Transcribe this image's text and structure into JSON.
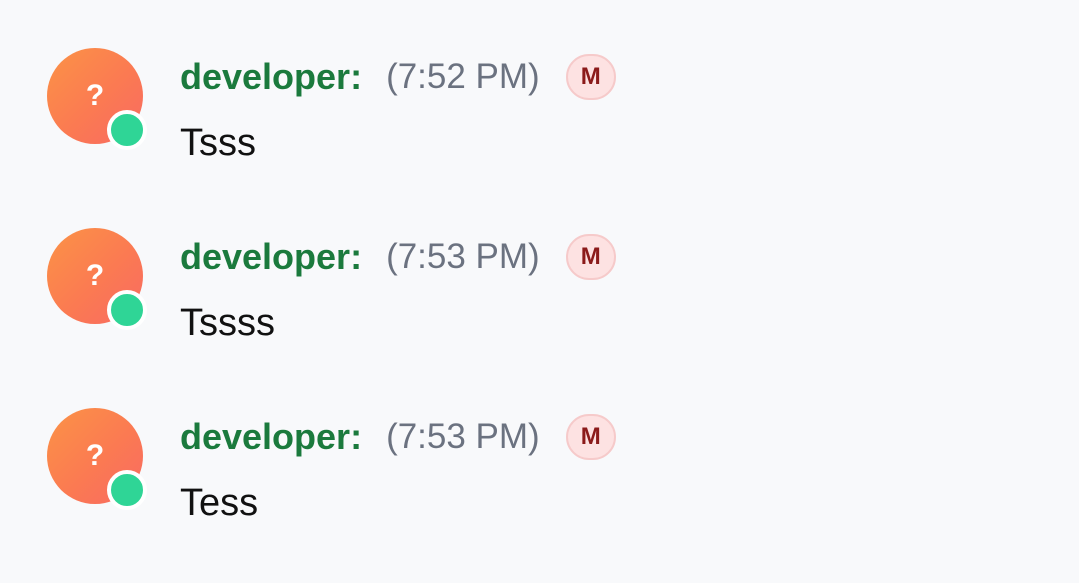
{
  "messages": [
    {
      "avatar_glyph": "?",
      "author": "developer:",
      "time": "(7:52 PM)",
      "badge": "M",
      "text": "Tsss"
    },
    {
      "avatar_glyph": "?",
      "author": "developer:",
      "time": "(7:53 PM)",
      "badge": "M",
      "text": "Tssss"
    },
    {
      "avatar_glyph": "?",
      "author": "developer:",
      "time": "(7:53 PM)",
      "badge": "M",
      "text": "Tess"
    }
  ],
  "colors": {
    "background": "#f8f9fb",
    "author": "#1b7a3d",
    "timestamp": "#6b7280",
    "online_status": "#2fd596",
    "badge_background": "#fde2e2",
    "badge_text": "#8b1a1a",
    "avatar_gradient_start": "#fb9346",
    "avatar_gradient_end": "#f86a63"
  },
  "icons": {
    "avatar": "unknown-user-avatar-icon",
    "status": "online-status-icon"
  }
}
